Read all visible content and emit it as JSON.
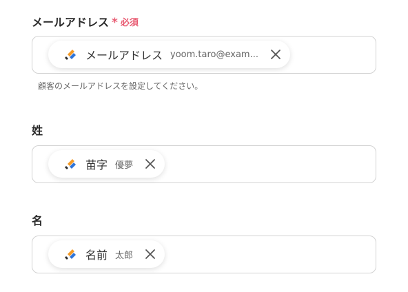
{
  "fields": [
    {
      "label": "メールアドレス",
      "required": "必須",
      "required_mark": "*",
      "chip": {
        "name": "メールアドレス",
        "value": "yoom.taro@exam..."
      },
      "help": "顧客のメールアドレスを設定してください。"
    },
    {
      "label": "姓",
      "chip": {
        "name": "苗字",
        "value": "優夢"
      }
    },
    {
      "label": "名",
      "chip": {
        "name": "名前",
        "value": "太郎"
      }
    }
  ],
  "colors": {
    "required": "#e85a71",
    "border": "#d2d2d2",
    "logo_orange": "#f39a26",
    "logo_blue": "#2f74d8",
    "logo_dark": "#2d2d2d"
  },
  "icons": {
    "chip_logo": "yoom-logo-icon",
    "remove": "close-icon"
  }
}
